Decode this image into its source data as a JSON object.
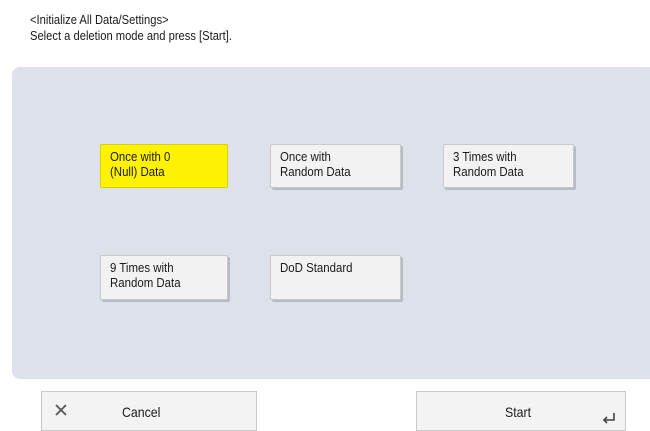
{
  "header": {
    "title": "<Initialize All Data/Settings>",
    "instruction": "Select a deletion mode and press [Start]."
  },
  "modes": [
    {
      "label": "Once with 0\n(Null) Data",
      "selected": true
    },
    {
      "label": "Once with\nRandom Data",
      "selected": false
    },
    {
      "label": "3 Times with\nRandom Data",
      "selected": false
    },
    {
      "label": "9 Times with\nRandom Data",
      "selected": false
    },
    {
      "label": "DoD Standard",
      "selected": false
    }
  ],
  "footer": {
    "cancel_label": "Cancel",
    "cancel_icon": "close-icon",
    "start_label": "Start",
    "start_icon": "enter-icon"
  },
  "colors": {
    "selected": "#fff200",
    "panel": "#dde1ea"
  }
}
